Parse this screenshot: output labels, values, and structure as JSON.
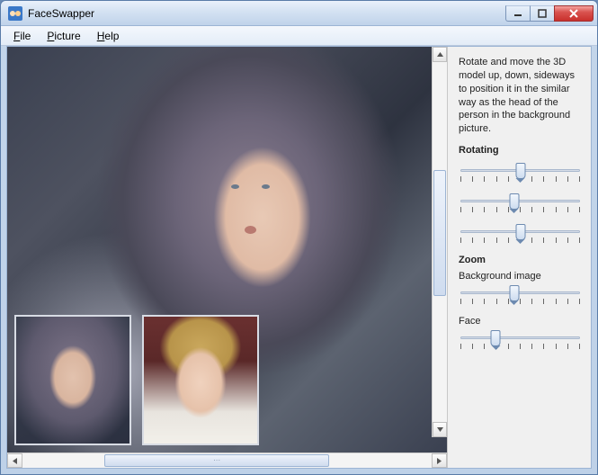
{
  "window": {
    "title": "FaceSwapper"
  },
  "menubar": {
    "file": "File",
    "picture": "Picture",
    "help": "Help"
  },
  "sidepanel": {
    "instruction": "Rotate and move the 3D model up, down, sideways to position it in the similar way as the head of the person in the background picture.",
    "rotating_title": "Rotating",
    "zoom_title": "Zoom",
    "zoom_bg_label": "Background image",
    "zoom_face_label": "Face",
    "sliders": {
      "rotate1": {
        "value": 50,
        "ticks": 11
      },
      "rotate2": {
        "value": 45,
        "ticks": 11
      },
      "rotate3": {
        "value": 50,
        "ticks": 11
      },
      "zoom_bg": {
        "value": 45,
        "ticks": 11
      },
      "zoom_face": {
        "value": 30,
        "ticks": 11
      }
    }
  },
  "viewport": {
    "main_image_desc": "Composite portrait: face swapped onto hooded figure",
    "thumb_a_desc": "Original hooded figure face",
    "thumb_b_desc": "Source face (blonde portrait)"
  }
}
